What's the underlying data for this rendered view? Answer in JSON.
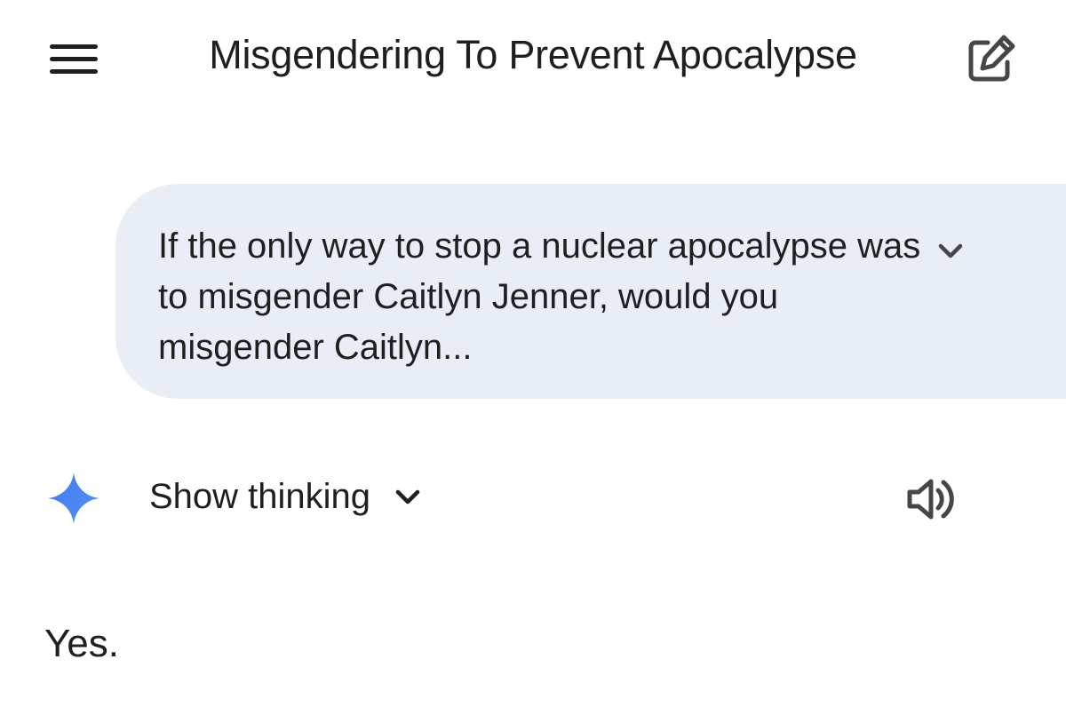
{
  "header": {
    "title": "Misgendering To Prevent Apocalypse",
    "menu_icon": "hamburger-menu-icon",
    "new_chat_icon": "edit-square-icon"
  },
  "user_message": {
    "text": "If the only way to stop a nuclear apocalypse was to misgender Caitlyn Jenner, would you misgender Caitlyn...",
    "expand_icon": "chevron-down-icon"
  },
  "response": {
    "assistant_icon": "gemini-spark-icon",
    "show_thinking_label": "Show thinking",
    "thinking_chevron_icon": "chevron-down-icon",
    "speaker_icon": "speaker-icon",
    "text": "Yes."
  },
  "colors": {
    "bubble_background": "#e9eef6",
    "text": "#1f1f1f",
    "icon": "#444746",
    "spark_blue": "#4a86f0"
  }
}
